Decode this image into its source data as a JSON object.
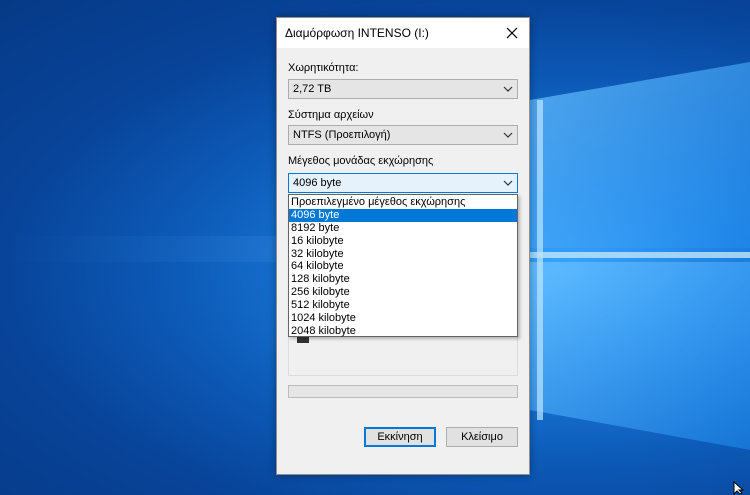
{
  "dialog": {
    "title": "Διαμόρφωση INTENSO (I:)",
    "capacity_label": "Χωρητικότητα:",
    "capacity_value": "2,72 TB",
    "filesystem_label": "Σύστημα αρχείων",
    "filesystem_value": "NTFS  (Προεπιλογή)",
    "allocation_label": "Μέγεθος μονάδας εκχώρησης",
    "allocation_value": "4096 byte",
    "allocation_options": [
      "Προεπιλεγμένο μέγεθος εκχώρησης",
      "4096 byte",
      "8192 byte",
      "16 kilobyte",
      "32 kilobyte",
      "64 kilobyte",
      "128 kilobyte",
      "256 kilobyte",
      "512 kilobyte",
      "1024 kilobyte",
      "2048 kilobyte"
    ],
    "selected_option_index": 1,
    "progress": 0,
    "start_button": "Εκκίνηση",
    "close_button": "Κλείσιμο"
  },
  "colors": {
    "accent": "#0078d7",
    "desktop_bg": "#0d5bb8",
    "dialog_bg": "#f0f0f0"
  },
  "icons": {
    "close": "close-icon",
    "chevron": "chevron-down-icon",
    "cursor": "mouse-cursor-icon"
  }
}
